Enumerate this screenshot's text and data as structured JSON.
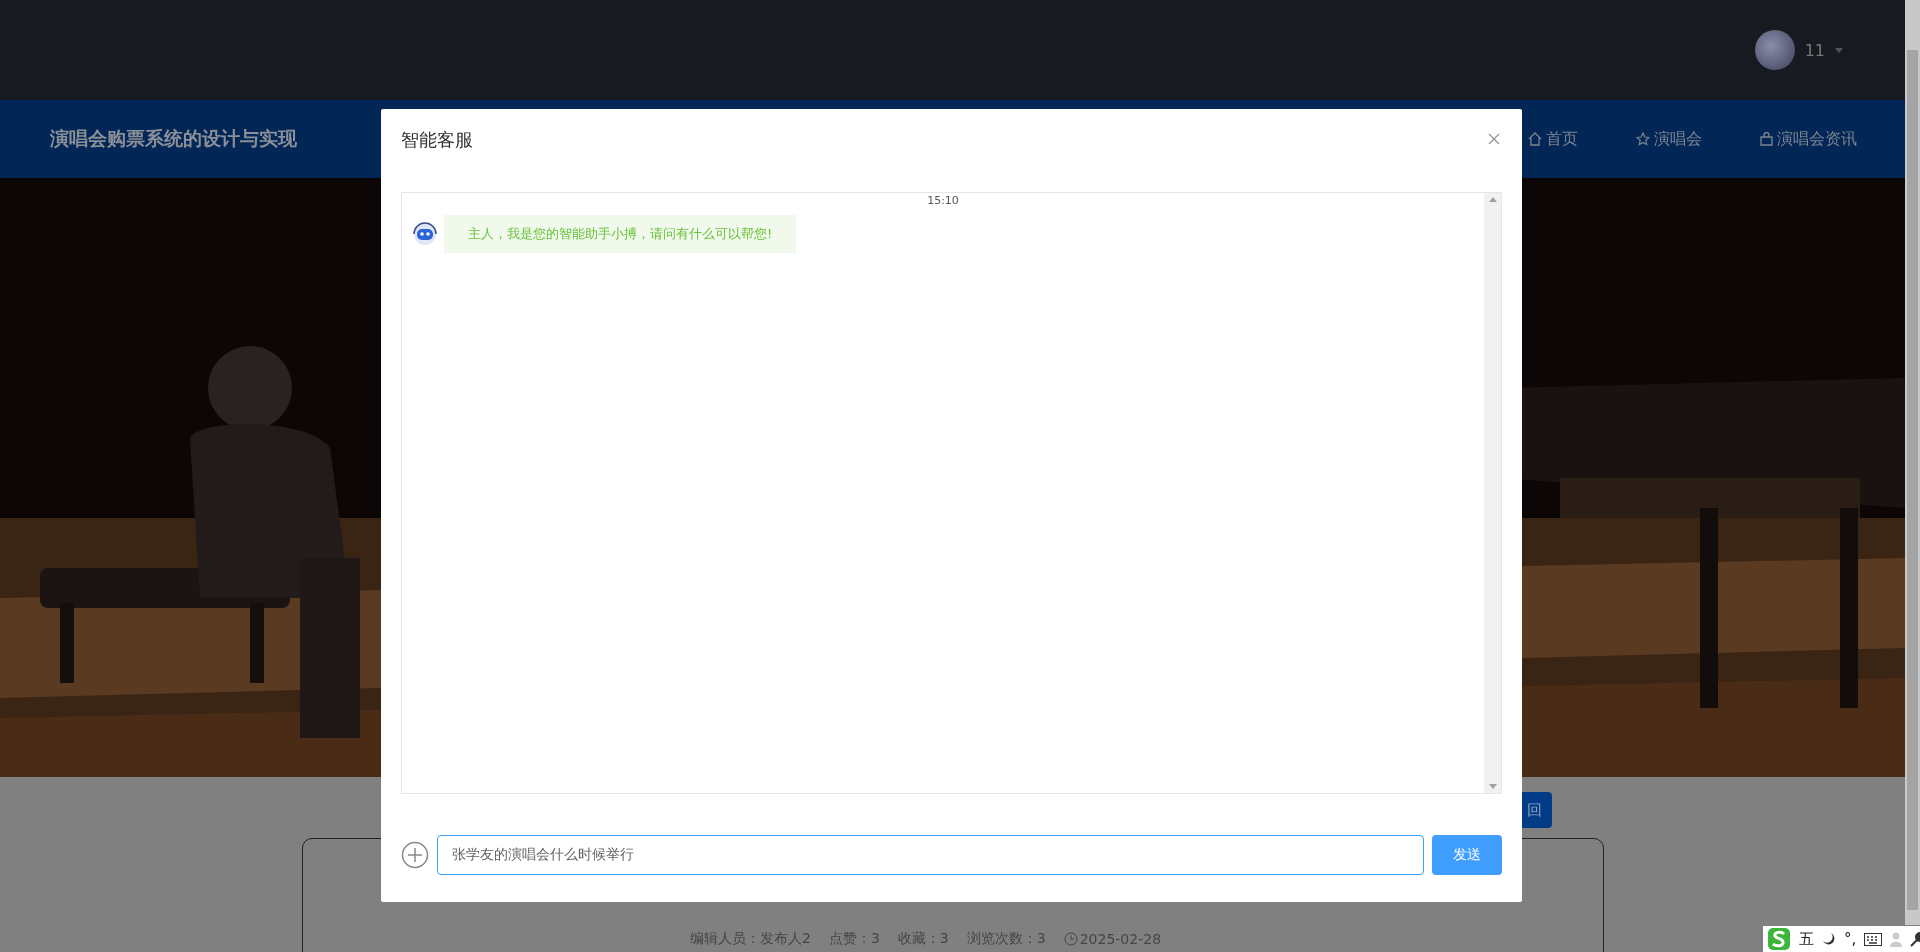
{
  "header": {
    "user": {
      "name": "11"
    }
  },
  "navbar": {
    "site_title": "演唱会购票系统的设计与实现",
    "items": [
      {
        "kind": "home",
        "label": "首页"
      },
      {
        "kind": "star",
        "label": "演唱会"
      },
      {
        "kind": "bag",
        "label": "演唱会资讯"
      }
    ]
  },
  "back_button": {
    "label": "回"
  },
  "meta": {
    "editor": "编辑人员：发布人2",
    "likes": "点赞：3",
    "favorites": "收藏：3",
    "views": "浏览次数：3",
    "date": "2025-02-28"
  },
  "dialog": {
    "title": "智能客服",
    "messages": [
      {
        "time": "15:10",
        "text": "主人，我是您的智能助手小搏，请问有什么可以帮您!"
      }
    ],
    "input": {
      "value": "张学友的演唱会什么时候举行"
    },
    "send_button": "发送"
  },
  "ime_toolbar": {
    "items": [
      {
        "kind": "logo"
      },
      {
        "kind": "text",
        "label": "五"
      },
      {
        "kind": "moon"
      },
      {
        "kind": "text",
        "label": "°,"
      },
      {
        "kind": "keyboard"
      },
      {
        "kind": "user"
      },
      {
        "kind": "wrench"
      }
    ]
  }
}
